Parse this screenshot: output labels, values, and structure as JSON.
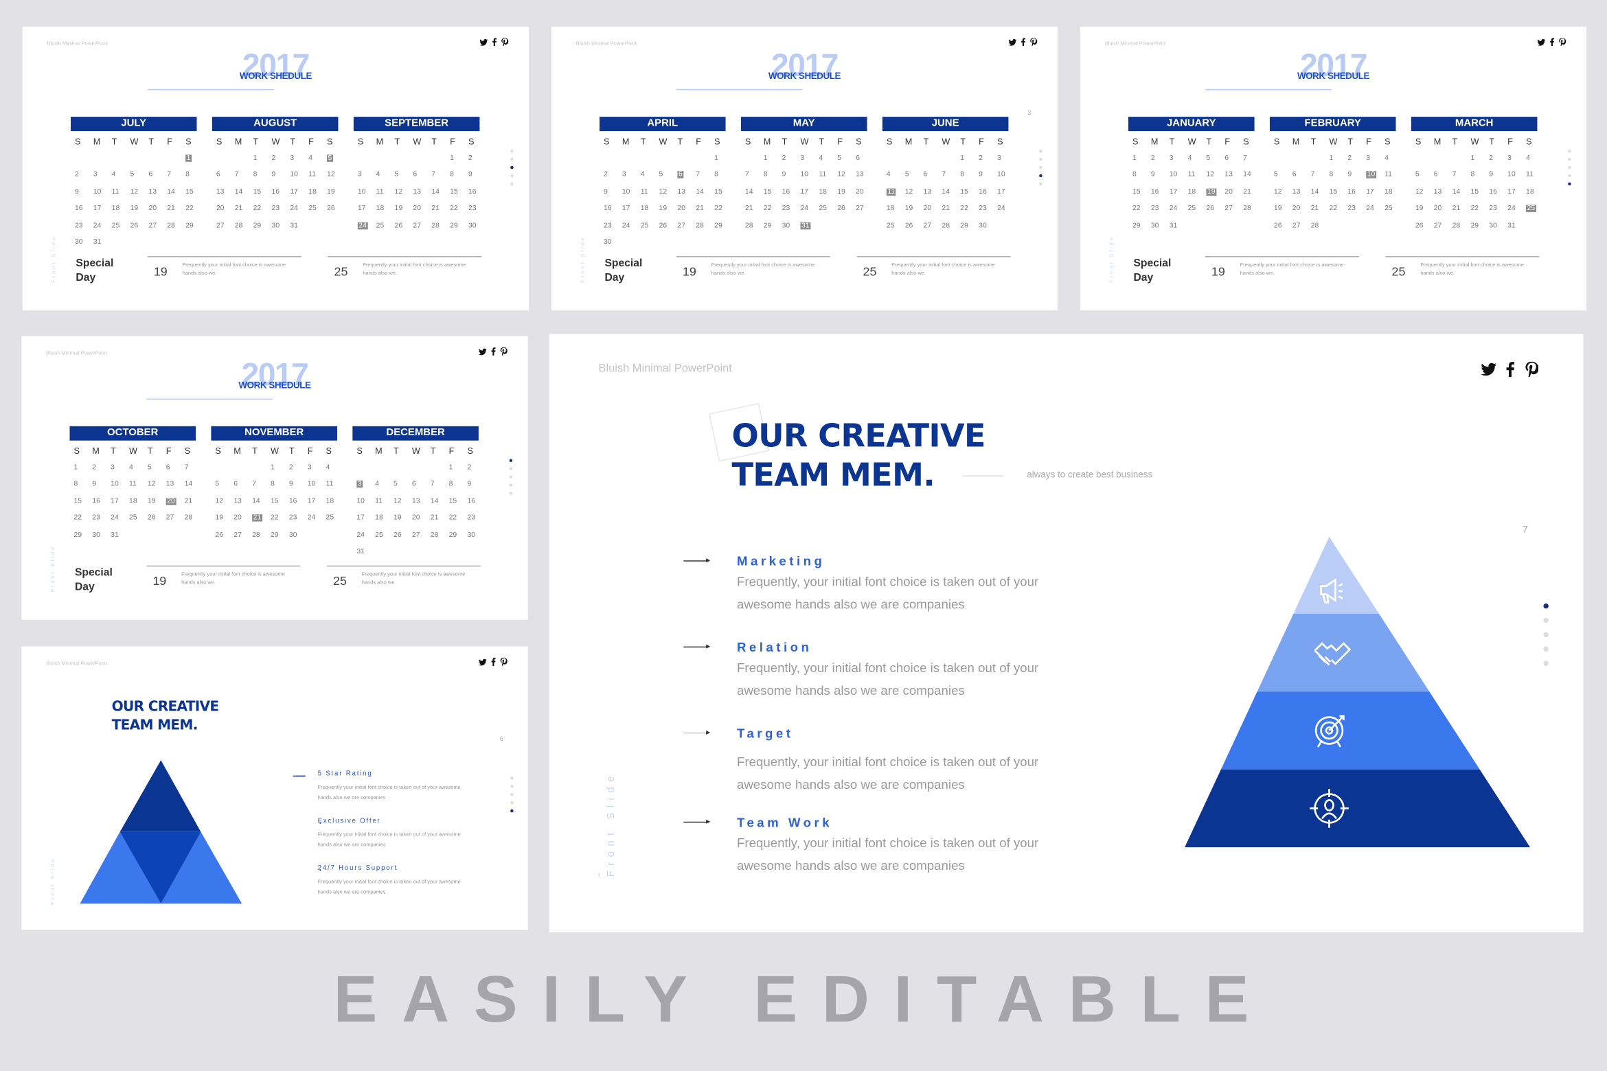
{
  "brand": "Bluish Minimal PowerPoint",
  "social_icons": [
    "twitter-icon",
    "facebook-icon",
    "pinterest-icon"
  ],
  "colors": {
    "background": "#e2e2e6",
    "navy": "#0c3592",
    "accent": "#2e62d9",
    "light": "#b9ccf5",
    "highlight": "#8c8c8c"
  },
  "calendar": {
    "year": "2017",
    "subtitle": "WORK SHEDULE",
    "weekdays": [
      "S",
      "M",
      "T",
      "W",
      "T",
      "F",
      "S"
    ],
    "special_label_1": "Special",
    "special_label_2": "Day",
    "special_days": [
      {
        "day": "19",
        "text": "Frequently your initial font choice is awesome hands also we."
      },
      {
        "day": "25",
        "text": "Frequently your initial font choice is awesome hands also we."
      }
    ],
    "slides": [
      {
        "page": "",
        "months": [
          {
            "name": "JULY",
            "start": 6,
            "days": 31,
            "hl": 1
          },
          {
            "name": "AUGUST",
            "start": 2,
            "days": 31,
            "hl": 5
          },
          {
            "name": "SEPTEMBER",
            "start": 5,
            "days": 30,
            "hl": 24
          }
        ]
      },
      {
        "page": "3",
        "months": [
          {
            "name": "APRIL",
            "start": 6,
            "days": 30,
            "hl": 6
          },
          {
            "name": "MAY",
            "start": 1,
            "days": 31,
            "hl": 31
          },
          {
            "name": "JUNE",
            "start": 4,
            "days": 30,
            "hl": 11
          }
        ]
      },
      {
        "page": "",
        "months": [
          {
            "name": "JANUARY",
            "start": 0,
            "days": 31,
            "hl": 19
          },
          {
            "name": "FEBRUARY",
            "start": 3,
            "days": 28,
            "hl": 10
          },
          {
            "name": "MARCH",
            "start": 3,
            "days": 31,
            "hl": 25
          }
        ]
      },
      {
        "page": "",
        "months": [
          {
            "name": "OCTOBER",
            "start": 0,
            "days": 31,
            "hl": 20
          },
          {
            "name": "NOVEMBER",
            "start": 3,
            "days": 30,
            "hl": 21
          },
          {
            "name": "DECEMBER",
            "start": 5,
            "days": 31,
            "hl": 3
          }
        ]
      }
    ]
  },
  "team_small": {
    "title_1": "OUR CREATIVE",
    "title_2": "TEAM MEM.",
    "page": "6",
    "side_label": "Front Slide",
    "items": [
      {
        "label": "5 Star Rating",
        "desc": "Frequently your initial font choice is taken out of your awesome hands also we are companies"
      },
      {
        "label": "Exclusive Offer",
        "desc": "Frequently your initial font choice is taken out of your awesome hands also we are companies"
      },
      {
        "label": "24/7 Hours Support",
        "desc": "Frequently your initial font choice is taken out of your awesome hands also we are companies"
      }
    ]
  },
  "team_big": {
    "title_1": "OUR CREATIVE",
    "title_2": "TEAM MEM.",
    "subtitle": "always to create best business",
    "side_label": "Front Slide",
    "page": "7",
    "items": [
      {
        "label": "Marketing",
        "desc_1": "Frequently, your initial font choice is taken out of your",
        "desc_2": "awesome hands also we are companies",
        "icon": "megaphone-icon"
      },
      {
        "label": "Relation",
        "desc_1": "Frequently, your initial font choice is taken out of your",
        "desc_2": "awesome hands also we are companies",
        "icon": "handshake-icon"
      },
      {
        "label": "Target",
        "desc_1": "Frequently, your initial font choice is taken out of your",
        "desc_2": "awesome hands also we are companies",
        "icon": "target-icon"
      },
      {
        "label": "Team Work",
        "desc_1": "Frequently, your initial font choice is taken out of your",
        "desc_2": "awesome hands also we are companies",
        "icon": "person-target-icon"
      }
    ],
    "pyramid_colors": [
      "#b9cdf6",
      "#7aa3f0",
      "#3b78ee",
      "#0b3592"
    ]
  },
  "tagline": "EASILY EDITABLE"
}
